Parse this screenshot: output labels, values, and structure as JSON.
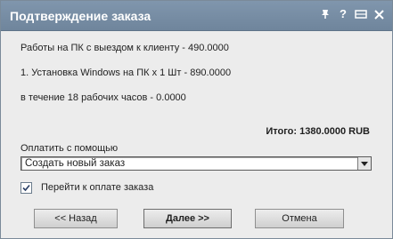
{
  "window": {
    "title": "Подтверждение заказа",
    "icons": [
      "pin-icon",
      "help-icon",
      "resize-icon",
      "close-icon"
    ]
  },
  "order": {
    "lines": [
      "Работы на ПК с выездом к клиенту - 490.0000",
      "1. Установка Windows на ПК x 1 Шт - 890.0000",
      "в течение 18 рабочих часов - 0.0000"
    ],
    "total": "Итого: 1380.0000 RUB"
  },
  "payment": {
    "label": "Оплатить с помощью",
    "selected": "Создать новый заказ"
  },
  "checkbox": {
    "label": "Перейти к оплате заказа",
    "checked": true
  },
  "buttons": {
    "back": "<< Назад",
    "next": "Далее >>",
    "cancel": "Отмена"
  }
}
